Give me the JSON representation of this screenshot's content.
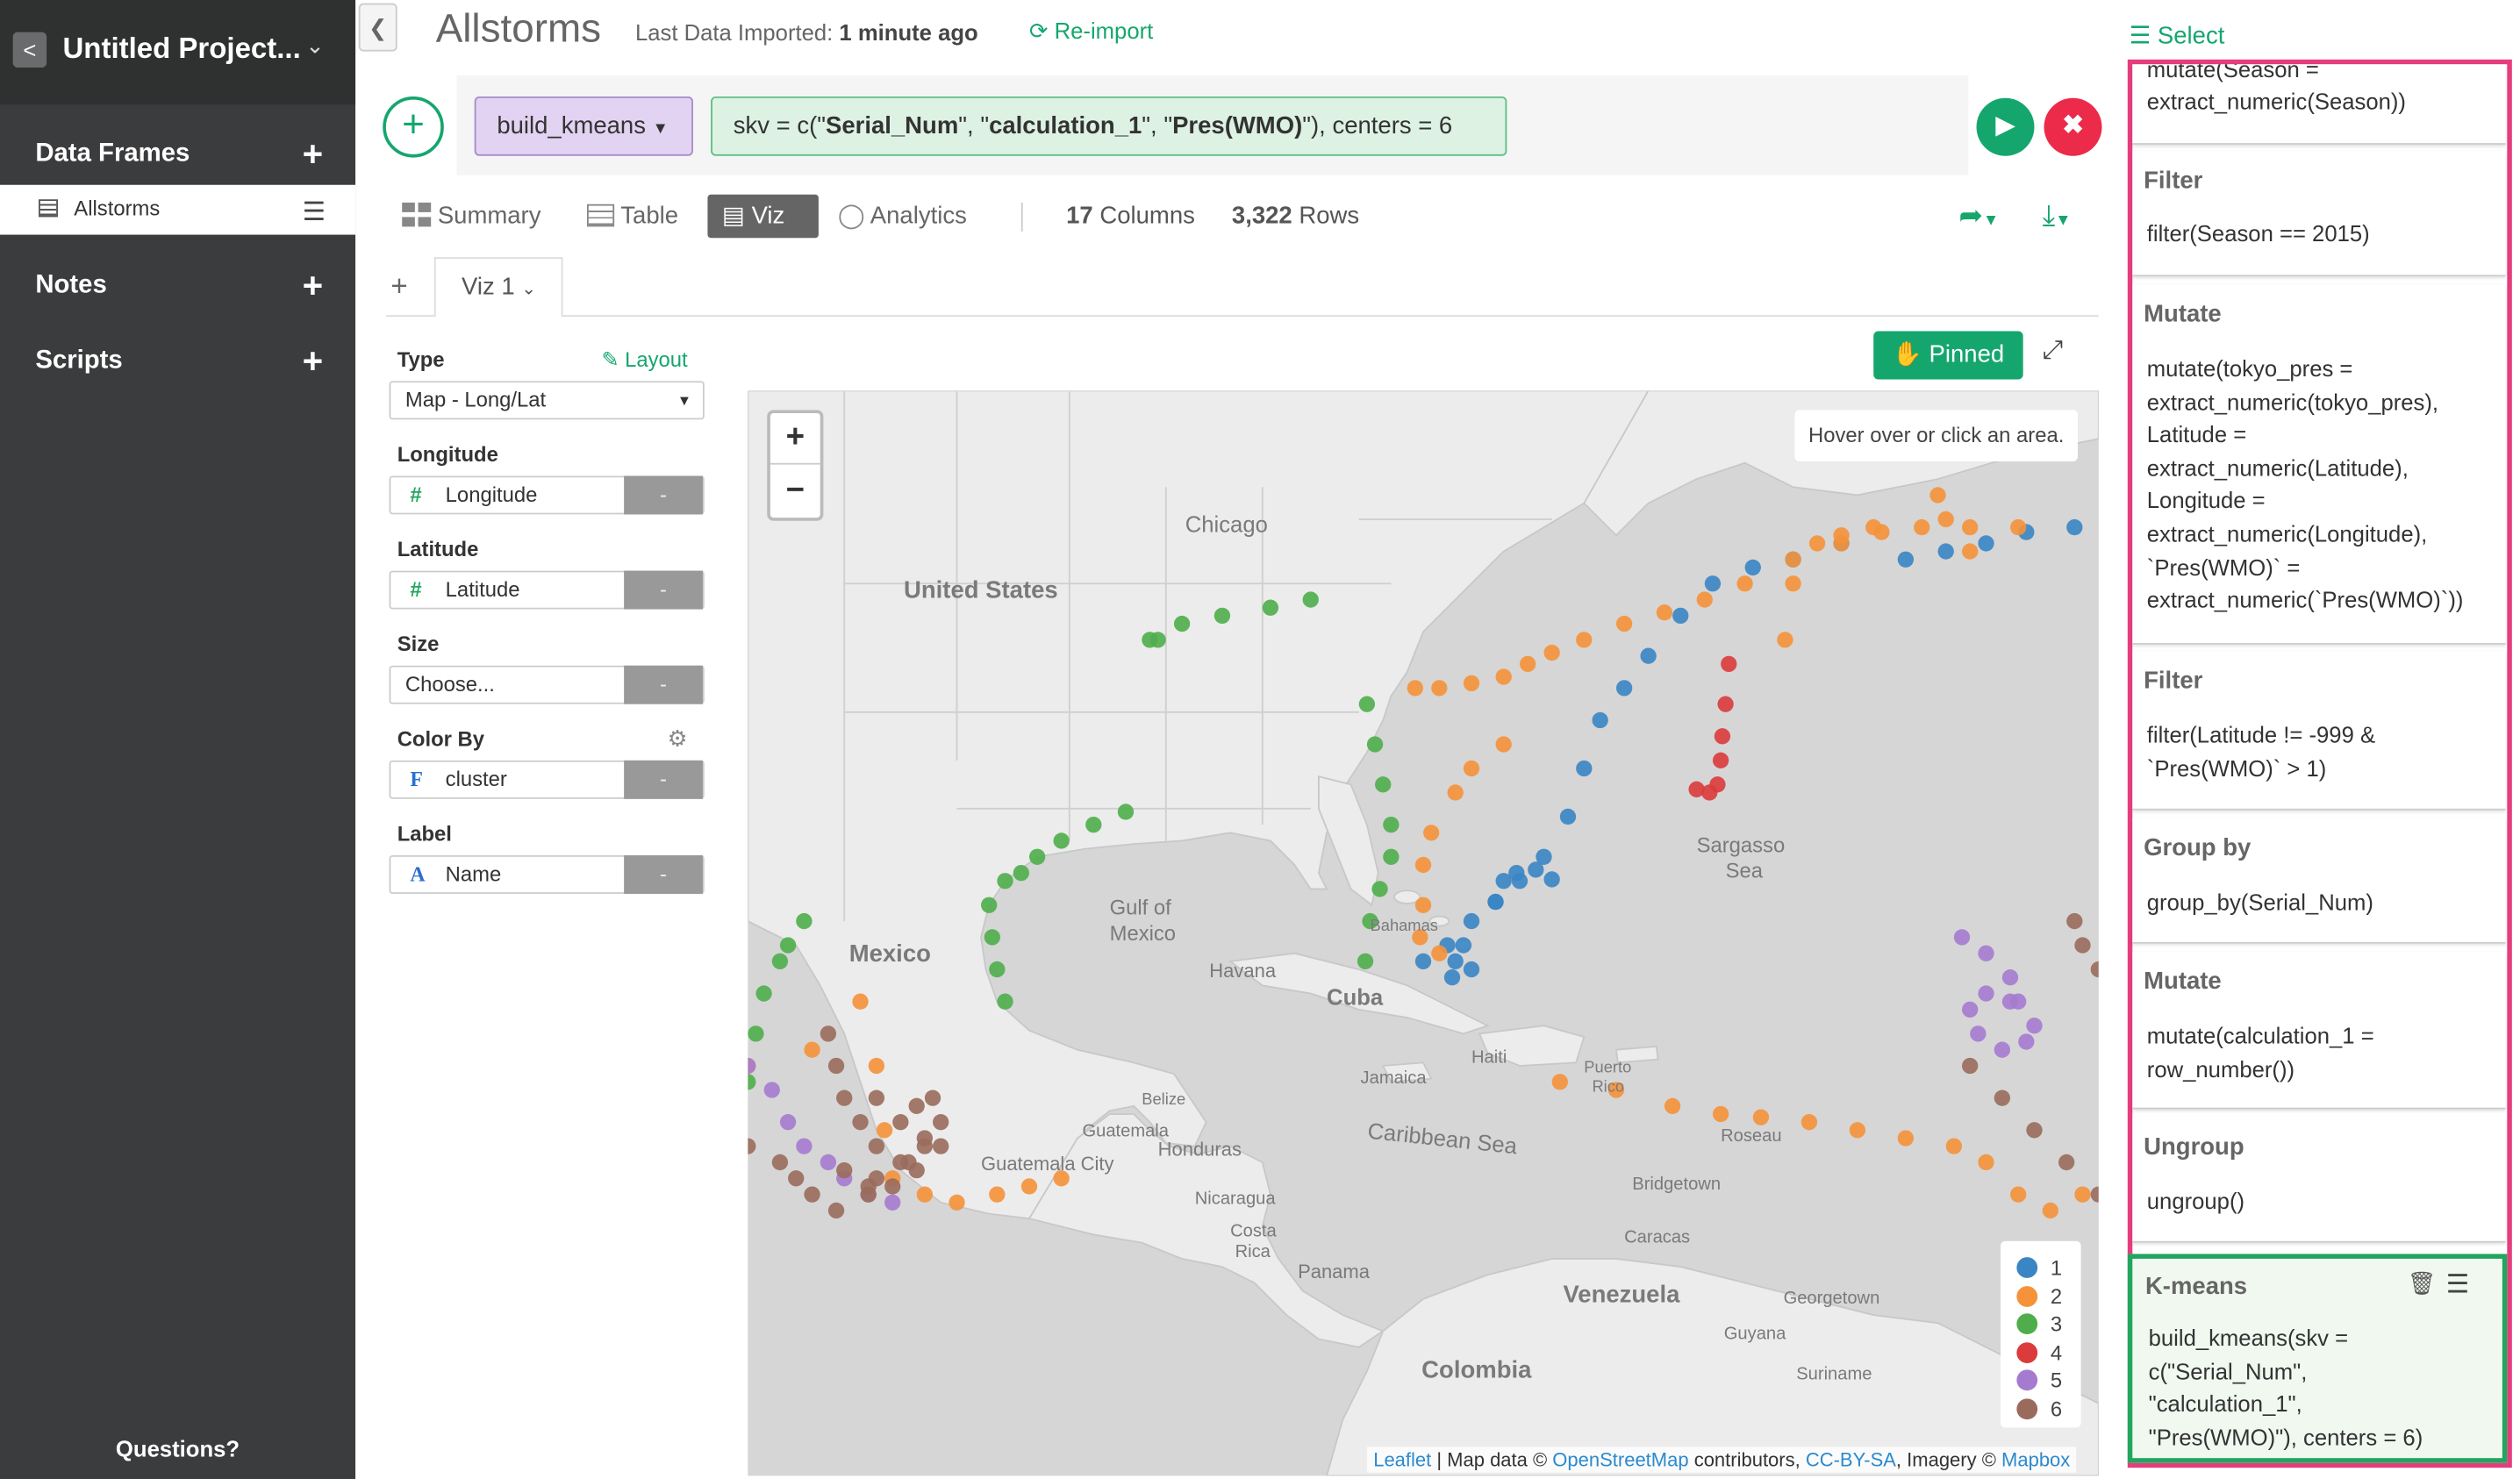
{
  "sidebar": {
    "project_title": "Untitled Project...",
    "sections": {
      "data_frames": "Data Frames",
      "notes": "Notes",
      "scripts": "Scripts"
    },
    "data_frame_item": "Allstorms",
    "questions": "Questions?"
  },
  "header": {
    "title": "Allstorms",
    "last_imported_label": "Last Data Imported:",
    "last_imported_value": "1 minute ago",
    "reimport": "Re-import"
  },
  "command": {
    "function": "build_kmeans",
    "args_plain_1": "skv = c(\"",
    "args_bold_1": "Serial_Num",
    "args_plain_2": "\", \"",
    "args_bold_2": "calculation_1",
    "args_plain_3": "\", \"",
    "args_bold_3": "Pres(WMO)",
    "args_plain_4": "\"), centers = 6"
  },
  "tabs": {
    "summary": "Summary",
    "table": "Table",
    "viz": "Viz",
    "analytics": "Analytics"
  },
  "stats": {
    "columns": "17",
    "columns_label": "Columns",
    "rows": "3,322",
    "rows_label": "Rows"
  },
  "viz_tab": "Viz 1",
  "config": {
    "type_label": "Type",
    "layout": "Layout",
    "type_value": "Map - Long/Lat",
    "longitude_label": "Longitude",
    "longitude_value": "Longitude",
    "latitude_label": "Latitude",
    "latitude_value": "Latitude",
    "size_label": "Size",
    "size_value": "Choose...",
    "color_label": "Color By",
    "color_value": "cluster",
    "label_label": "Label",
    "label_value": "Name",
    "dash": "-"
  },
  "map": {
    "pinned": "Pinned",
    "hover_text": "Hover over or click an area.",
    "zoom_in": "+",
    "zoom_out": "−",
    "places": {
      "chicago": "Chicago",
      "united_states": "United States",
      "gulf_of_mexico": "Gulf of",
      "gulf_of_mexico_2": "Mexico",
      "mexico": "Mexico",
      "havana": "Havana",
      "cuba": "Cuba",
      "haiti": "Haiti",
      "jamaica": "Jamaica",
      "sargasso": "Sargasso",
      "sargasso_2": "Sea",
      "caribbean": "Caribbean Sea",
      "venezuela": "Venezuela",
      "colombia": "Colombia",
      "guatemala": "Guatemala",
      "honduras": "Honduras",
      "nicaragua": "Nicaragua",
      "belize": "Belize",
      "panama": "Panama",
      "costa": "Costa",
      "costa_2": "Rica",
      "bahamas": "Bahamas",
      "puerto": "Puerto",
      "puerto_2": "Rico",
      "caracas": "Caracas",
      "guyana": "Guyana",
      "suriname": "Suriname",
      "georgetown": "Georgetown",
      "bridgetown": "Bridgetown",
      "roseau": "Roseau",
      "guatemala_city": "Guatemala City"
    },
    "legend": [
      {
        "label": "1",
        "color": "#3a85c4"
      },
      {
        "label": "2",
        "color": "#f5923a"
      },
      {
        "label": "3",
        "color": "#4fae4b"
      },
      {
        "label": "4",
        "color": "#dc3b3b"
      },
      {
        "label": "5",
        "color": "#a57bd0"
      },
      {
        "label": "6",
        "color": "#9a6b5c"
      }
    ],
    "attribution": {
      "leaflet": "Leaflet",
      "map_data": " | Map data © ",
      "osm": "OpenStreetMap",
      "contributors": " contributors, ",
      "license": "CC-BY-SA",
      "imagery": ", Imagery © ",
      "mapbox": "Mapbox"
    }
  },
  "steps_panel": {
    "select": "Select",
    "steps": [
      {
        "title": "",
        "code": "extract_numeric(Season))",
        "code_top": "mutate(Season ="
      },
      {
        "title": "Filter",
        "code": "filter(Season == 2015)"
      },
      {
        "title": "Mutate",
        "lines": [
          "mutate(tokyo_pres =",
          "extract_numeric(tokyo_pres),",
          "Latitude =",
          "extract_numeric(Latitude),",
          "Longitude =",
          "extract_numeric(Longitude),",
          "`Pres(WMO)` =",
          "extract_numeric(`Pres(WMO)`))"
        ]
      },
      {
        "title": "Filter",
        "lines": [
          "filter(Latitude != -999 &",
          "`Pres(WMO)` > 1)"
        ]
      },
      {
        "title": "Group by",
        "code": "group_by(Serial_Num)"
      },
      {
        "title": "Mutate",
        "lines": [
          "mutate(calculation_1 =",
          "row_number())"
        ]
      },
      {
        "title": "Ungroup",
        "code": "ungroup()"
      },
      {
        "title": "K-means",
        "lines": [
          "build_kmeans(skv =",
          "c(\"Serial_Num\",",
          "\"calculation_1\",",
          "\"Pres(WMO)\"), centers = 6)"
        ]
      }
    ]
  }
}
